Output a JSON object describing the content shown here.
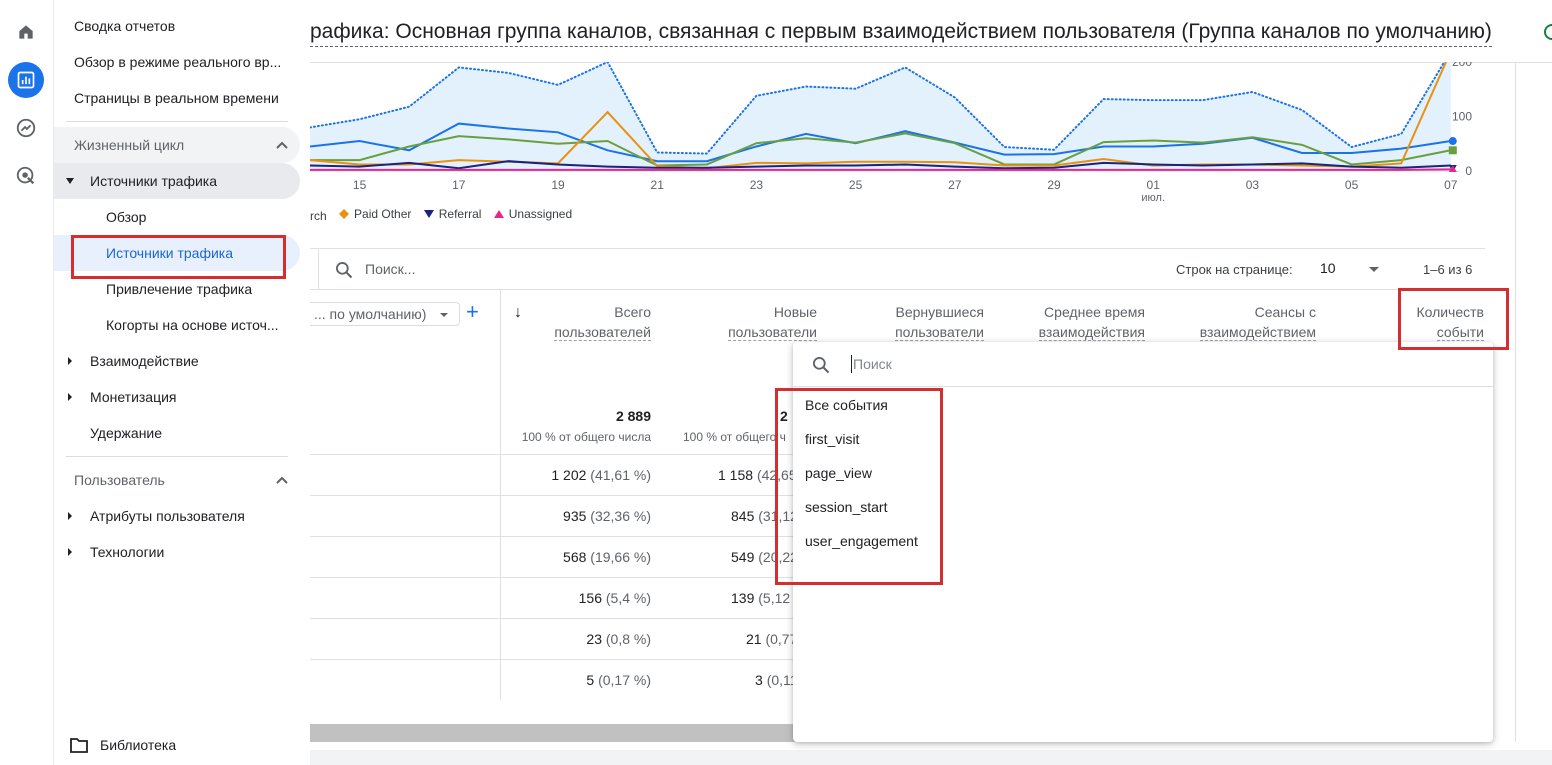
{
  "rail": {
    "icons": [
      "home-icon",
      "reports-icon",
      "explore-icon",
      "advertising-icon"
    ]
  },
  "sidebar": {
    "top_items": [
      "Сводка отчетов",
      "Обзор в режиме реального вр...",
      "Страницы в реальном времени"
    ],
    "lifecycle_label": "Жизненный цикл",
    "traffic_group": "Источники трафика",
    "traffic_children": [
      "Обзор",
      "Источники трафика",
      "Привлечение трафика",
      "Когорты на основе источ..."
    ],
    "engagement": "Взаимодействие",
    "monetization": "Монетизация",
    "retention": "Удержание",
    "user_label": "Пользователь",
    "user_attrs": "Атрибуты пользователя",
    "tech": "Технологии",
    "library": "Библиотека"
  },
  "header": {
    "title": "рафика: Основная группа каналов, связанная с первым взаимодействием пользователя (Группа каналов по умолчанию)"
  },
  "chart_data": {
    "type": "line",
    "x": [
      "14",
      "15",
      "16",
      "17",
      "18",
      "19",
      "20",
      "21",
      "22",
      "23",
      "24",
      "25",
      "26",
      "27",
      "28",
      "29",
      "30",
      "01",
      "02",
      "03",
      "04",
      "05",
      "06",
      "07"
    ],
    "x_tick_labels": [
      "15",
      "17",
      "19",
      "21",
      "23",
      "25",
      "27",
      "29",
      "01",
      "03",
      "05",
      "07"
    ],
    "x_sublabel": "июл.",
    "y_tick_labels": [
      "0",
      "100",
      "200"
    ],
    "ylim": [
      0,
      200
    ],
    "series": [
      {
        "name": "",
        "color": "#1a73e8",
        "style": "dotted",
        "values": [
          80,
          95,
          118,
          190,
          180,
          158,
          200,
          34,
          32,
          138,
          155,
          151,
          190,
          135,
          44,
          39,
          132,
          130,
          130,
          145,
          112,
          44,
          68,
          300
        ]
      },
      {
        "name": "",
        "color": "#1a73e8",
        "values": [
          45,
          55,
          38,
          87,
          78,
          71,
          38,
          18,
          18,
          45,
          68,
          51,
          73,
          52,
          30,
          31,
          45,
          45,
          50,
          61,
          33,
          33,
          41,
          55
        ]
      },
      {
        "name": "",
        "color": "#6a9f3f",
        "values": [
          20,
          20,
          45,
          64,
          58,
          50,
          55,
          10,
          12,
          51,
          60,
          52,
          69,
          51,
          12,
          12,
          53,
          56,
          52,
          62,
          48,
          12,
          20,
          38
        ]
      },
      {
        "name": "Paid Other",
        "color": "#e8920f",
        "values": [
          20,
          12,
          12,
          20,
          17,
          14,
          108,
          9,
          5,
          15,
          14,
          17,
          17,
          16,
          10,
          10,
          22,
          10,
          12,
          12,
          10,
          8,
          14,
          300
        ]
      },
      {
        "name": "Referral",
        "color": "#1a237e",
        "values": [
          10,
          8,
          15,
          5,
          18,
          12,
          8,
          6,
          6,
          8,
          10,
          10,
          12,
          8,
          5,
          6,
          15,
          12,
          10,
          12,
          14,
          8,
          6,
          10
        ]
      },
      {
        "name": "Unassigned",
        "color": "#e52592",
        "values": [
          2,
          2,
          2,
          2,
          2,
          2,
          2,
          2,
          2,
          2,
          2,
          2,
          2,
          2,
          2,
          2,
          2,
          2,
          2,
          2,
          2,
          2,
          2,
          3
        ]
      }
    ],
    "legend_partial": "rch",
    "legend_position": "bottom"
  },
  "toolbar": {
    "search_placeholder": "Поиск...",
    "rows_label": "Строк на странице:",
    "rows_value": "10",
    "pagination": "1–6 из 6",
    "dimension_select": "... по умолчанию)",
    "add_icon": "+"
  },
  "table": {
    "headers": [
      {
        "l1": "Всего",
        "l2": "пользователей"
      },
      {
        "l1": "Новые",
        "l2": "пользователи"
      },
      {
        "l1": "Вернувшиеся",
        "l2": "пользователи"
      },
      {
        "l1": "Среднее время",
        "l2": "взаимодействия"
      },
      {
        "l1": "Сеансы с",
        "l2": "взаимодействием"
      },
      {
        "l1": "Количеств",
        "l2": "событи"
      }
    ],
    "sort_icon": "↓",
    "total_users": "2 889",
    "total_users_pct": "100 % от общего числа",
    "total_new_partial": "2",
    "total_new_pct": "100 % от общего ч",
    "rows": [
      {
        "users": "1 202",
        "users_pct": "(41,61 %)",
        "new": "1 158",
        "new_pct": "(42,65"
      },
      {
        "users": "935",
        "users_pct": "(32,36 %)",
        "new": "845",
        "new_pct": "(31,12"
      },
      {
        "users": "568",
        "users_pct": "(19,66 %)",
        "new": "549",
        "new_pct": "(20,22"
      },
      {
        "users": "156",
        "users_pct": "(5,4 %)",
        "new": "139",
        "new_pct": "(5,12"
      },
      {
        "users": "23",
        "users_pct": "(0,8 %)",
        "new": "21",
        "new_pct": "(0,77"
      },
      {
        "users": "5",
        "users_pct": "(0,17 %)",
        "new": "3",
        "new_pct": "(0,11"
      }
    ]
  },
  "dropdown": {
    "search_placeholder": "Поиск",
    "items": [
      "Все события",
      "first_visit",
      "page_view",
      "session_start",
      "user_engagement"
    ]
  },
  "colors": {
    "accent": "#1a73e8",
    "highlight": "#d32f2f",
    "selected_bg": "#e8f0fe"
  }
}
